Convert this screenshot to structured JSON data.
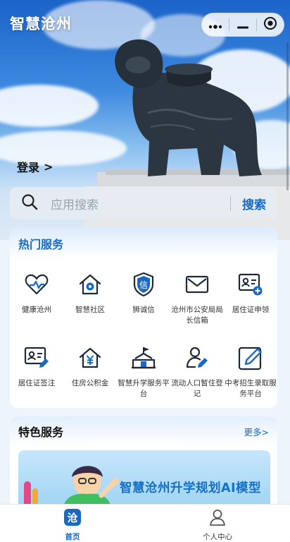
{
  "header": {
    "app_title": "智慧沧州",
    "login_label": "登录",
    "login_arrow": ">"
  },
  "capsule": {
    "more_icon": "ellipsis-icon",
    "minimize_icon": "minimize-icon",
    "close_icon": "target-close-icon"
  },
  "search": {
    "placeholder": "应用搜索",
    "button_label": "搜索",
    "icon": "search-icon"
  },
  "hot_services": {
    "title": "热门服务",
    "items": [
      {
        "label": "健康沧州",
        "icon": "heart-pulse-icon"
      },
      {
        "label": "智慧社区",
        "icon": "house-gear-icon"
      },
      {
        "label": "狮诚信",
        "icon": "shield-credit-icon"
      },
      {
        "label": "沧州市公安局局长信箱",
        "icon": "mail-icon"
      },
      {
        "label": "居住证申领",
        "icon": "id-card-add-icon"
      },
      {
        "label": "居住证签注",
        "icon": "id-card-edit-icon"
      },
      {
        "label": "住房公积金",
        "icon": "house-yen-icon"
      },
      {
        "label": "智慧升学服务平台",
        "icon": "school-flag-icon"
      },
      {
        "label": "流动人口暂住登记",
        "icon": "person-edit-icon"
      },
      {
        "label": "中考招生录取服务平台",
        "icon": "pencil-square-icon"
      }
    ]
  },
  "featured": {
    "title": "特色服务",
    "more_label": "更多>",
    "banner_text": "智慧沧州升学规划AI模型"
  },
  "tabbar": {
    "tabs": [
      {
        "label": "首页",
        "icon": "cang-logo-icon",
        "active": true
      },
      {
        "label": "个人中心",
        "icon": "user-icon",
        "active": false
      }
    ]
  },
  "colors": {
    "accent": "#1769c4",
    "title_white": "#ffffff"
  }
}
